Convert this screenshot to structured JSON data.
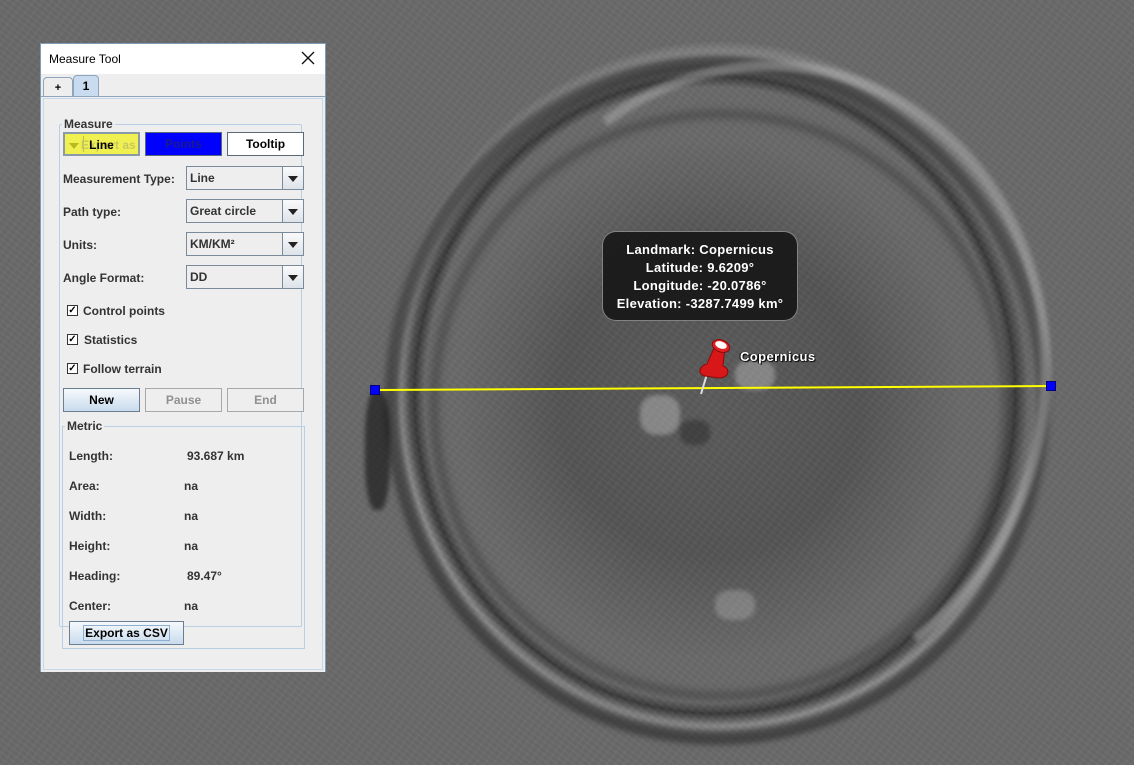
{
  "window": {
    "title": "Measure Tool",
    "close_icon": "close-icon",
    "tabs": [
      {
        "label": "+",
        "selected": false
      },
      {
        "label": "1",
        "selected": true
      }
    ]
  },
  "measure": {
    "section_title": "Measure",
    "line_color_button": {
      "label": "Line",
      "ghost_label": "Export as",
      "color": "#f0f050"
    },
    "points_color_button": {
      "label": "Points",
      "color": "#0000ff"
    },
    "tooltip_button": {
      "label": "Tooltip",
      "color": "#ffffff"
    },
    "fields": [
      {
        "label": "Measurement Type:",
        "value": "Line"
      },
      {
        "label": "Path type:",
        "value": "Great circle"
      },
      {
        "label": "Units:",
        "value": "KM/KM²"
      },
      {
        "label": "Angle Format:",
        "value": "DD"
      }
    ],
    "checkboxes": [
      {
        "label": "Control points",
        "checked": true
      },
      {
        "label": "Statistics",
        "checked": true
      },
      {
        "label": "Follow terrain",
        "checked": true
      }
    ],
    "actions": {
      "new": "New",
      "pause": "Pause",
      "end": "End"
    }
  },
  "metric": {
    "section_title": "Metric",
    "rows": [
      {
        "label": "Length:",
        "value": "93.687 km"
      },
      {
        "label": "Area:",
        "value": "na"
      },
      {
        "label": "Width:",
        "value": "na"
      },
      {
        "label": "Height:",
        "value": "na"
      },
      {
        "label": "Heading:",
        "value": "89.47°"
      },
      {
        "label": "Center:",
        "value": "na"
      }
    ],
    "export_button": "Export as CSV"
  },
  "map": {
    "measure_line_color": "#ffff00",
    "control_point_color": "#0000ff",
    "tooltip": {
      "lines": [
        "Landmark: Copernicus",
        "Latitude:  9.6209°",
        "Longitude: -20.0786°",
        "Elevation: -3287.7499 km°"
      ]
    },
    "placemark": {
      "label": "Copernicus",
      "icon": "pushpin-icon",
      "color": "#e02020"
    }
  }
}
